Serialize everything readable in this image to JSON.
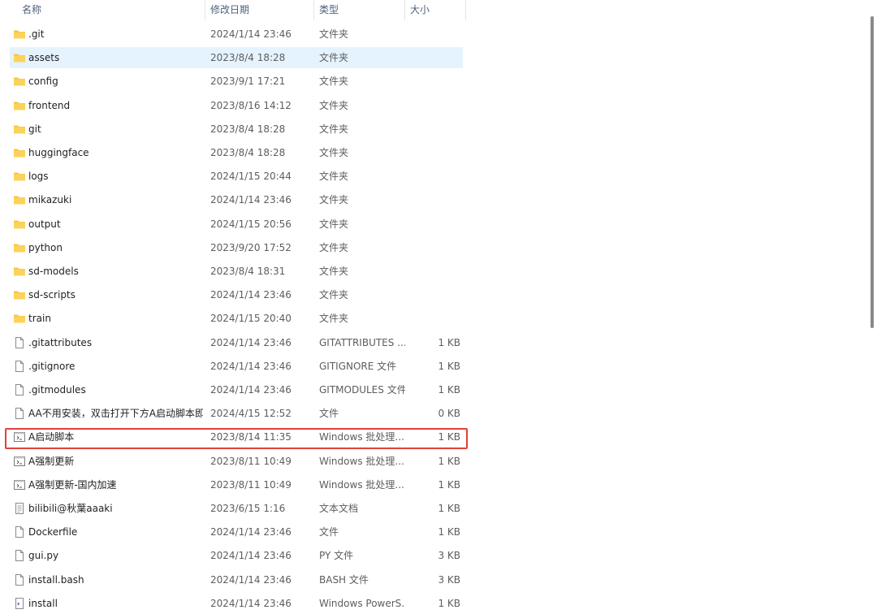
{
  "header": {
    "name": "名称",
    "date": "修改日期",
    "type": "类型",
    "size": "大小"
  },
  "files": [
    {
      "name": ".git",
      "date": "2024/1/14 23:46",
      "type": "文件夹",
      "size": "",
      "icon": "folder-icon"
    },
    {
      "name": "assets",
      "date": "2023/8/4 18:28",
      "type": "文件夹",
      "size": "",
      "icon": "folder-icon",
      "selected": true
    },
    {
      "name": "config",
      "date": "2023/9/1 17:21",
      "type": "文件夹",
      "size": "",
      "icon": "folder-icon"
    },
    {
      "name": "frontend",
      "date": "2023/8/16 14:12",
      "type": "文件夹",
      "size": "",
      "icon": "folder-icon"
    },
    {
      "name": "git",
      "date": "2023/8/4 18:28",
      "type": "文件夹",
      "size": "",
      "icon": "folder-icon"
    },
    {
      "name": "huggingface",
      "date": "2023/8/4 18:28",
      "type": "文件夹",
      "size": "",
      "icon": "folder-icon"
    },
    {
      "name": "logs",
      "date": "2024/1/15 20:44",
      "type": "文件夹",
      "size": "",
      "icon": "folder-icon"
    },
    {
      "name": "mikazuki",
      "date": "2024/1/14 23:46",
      "type": "文件夹",
      "size": "",
      "icon": "folder-icon"
    },
    {
      "name": "output",
      "date": "2024/1/15 20:56",
      "type": "文件夹",
      "size": "",
      "icon": "folder-icon"
    },
    {
      "name": "python",
      "date": "2023/9/20 17:52",
      "type": "文件夹",
      "size": "",
      "icon": "folder-icon"
    },
    {
      "name": "sd-models",
      "date": "2023/8/4 18:31",
      "type": "文件夹",
      "size": "",
      "icon": "folder-icon"
    },
    {
      "name": "sd-scripts",
      "date": "2024/1/14 23:46",
      "type": "文件夹",
      "size": "",
      "icon": "folder-icon"
    },
    {
      "name": "train",
      "date": "2024/1/15 20:40",
      "type": "文件夹",
      "size": "",
      "icon": "folder-icon"
    },
    {
      "name": ".gitattributes",
      "date": "2024/1/14 23:46",
      "type": "GITATTRIBUTES ...",
      "size": "1 KB",
      "icon": "file-icon"
    },
    {
      "name": ".gitignore",
      "date": "2024/1/14 23:46",
      "type": "GITIGNORE 文件",
      "size": "1 KB",
      "icon": "file-icon"
    },
    {
      "name": ".gitmodules",
      "date": "2024/1/14 23:46",
      "type": "GITMODULES 文件",
      "size": "1 KB",
      "icon": "file-icon"
    },
    {
      "name": "AA不用安装，双击打开下方A启动脚本即...",
      "date": "2024/4/15 12:52",
      "type": "文件",
      "size": "0 KB",
      "icon": "file-icon"
    },
    {
      "name": "A启动脚本",
      "date": "2023/8/14 11:35",
      "type": "Windows 批处理...",
      "size": "1 KB",
      "icon": "batch-file-icon",
      "highlighted": true
    },
    {
      "name": "A强制更新",
      "date": "2023/8/11 10:49",
      "type": "Windows 批处理...",
      "size": "1 KB",
      "icon": "batch-file-icon"
    },
    {
      "name": "A强制更新-国内加速",
      "date": "2023/8/11 10:49",
      "type": "Windows 批处理...",
      "size": "1 KB",
      "icon": "batch-file-icon"
    },
    {
      "name": "bilibili@秋葉aaaki",
      "date": "2023/6/15 1:16",
      "type": "文本文档",
      "size": "1 KB",
      "icon": "text-file-icon"
    },
    {
      "name": "Dockerfile",
      "date": "2024/1/14 23:46",
      "type": "文件",
      "size": "1 KB",
      "icon": "file-icon"
    },
    {
      "name": "gui.py",
      "date": "2024/1/14 23:46",
      "type": "PY 文件",
      "size": "3 KB",
      "icon": "python-file-icon"
    },
    {
      "name": "install.bash",
      "date": "2024/1/14 23:46",
      "type": "BASH 文件",
      "size": "3 KB",
      "icon": "file-icon"
    },
    {
      "name": "install",
      "date": "2024/1/14 23:46",
      "type": "Windows PowerS...",
      "size": "1 KB",
      "icon": "powershell-file-icon"
    }
  ],
  "colors": {
    "folder": "#f8c33c",
    "selection": "#e5f3ff",
    "highlight_border": "#e0413a"
  }
}
